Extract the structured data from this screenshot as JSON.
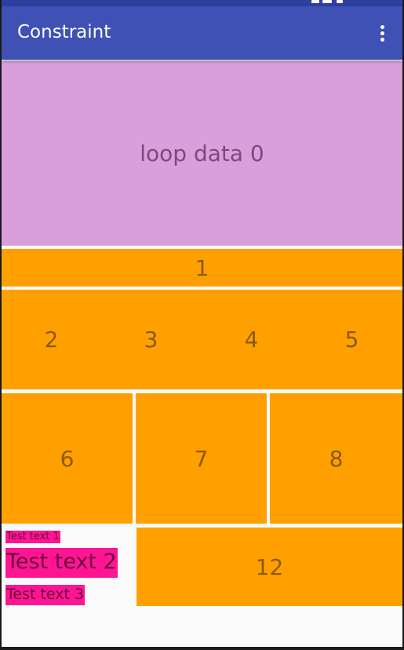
{
  "app": {
    "title": "Constraint",
    "overflow_icon": "more-vert-icon",
    "primary_color": "#3F51B5",
    "status_bar_color": "#303F9F"
  },
  "loop": {
    "label": "loop data 0",
    "color": "#DA9FDB"
  },
  "cells": {
    "c1": "1",
    "c2": "2",
    "c3": "3",
    "c4": "4",
    "c5": "5",
    "c6": "6",
    "c7": "7",
    "c8": "8",
    "c12": "12",
    "color": "#FFA000"
  },
  "texts": {
    "t1": "Test text 1",
    "t2": "Test text 2",
    "t3": "Test text 3",
    "color": "#FF1493"
  }
}
